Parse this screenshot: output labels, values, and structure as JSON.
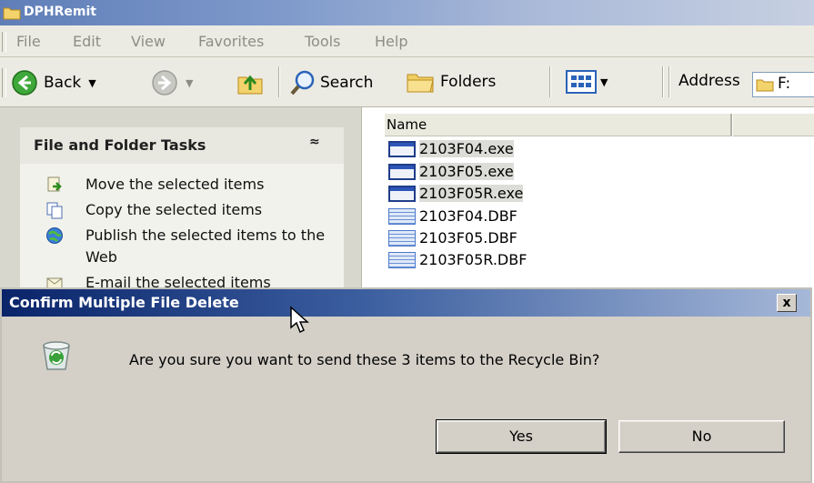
{
  "window": {
    "title": "DPHRemit"
  },
  "menu": [
    "File",
    "Edit",
    "View",
    "Favorites",
    "Tools",
    "Help"
  ],
  "toolbar": {
    "back": "Back",
    "search": "Search",
    "folders": "Folders",
    "address_label": "Address",
    "address_value": "F:"
  },
  "task_pane": {
    "header": "File and Folder Tasks",
    "collapse_glyph": "≈",
    "items": [
      {
        "label": "Move the selected items",
        "icon": "move-icon"
      },
      {
        "label": "Copy the selected items",
        "icon": "copy-icon"
      },
      {
        "label": "Publish the selected items to the Web",
        "icon": "publish-web-icon"
      },
      {
        "label": "E-mail the selected items",
        "icon": "email-icon"
      }
    ]
  },
  "file_list": {
    "column_name": "Name",
    "files": [
      {
        "name": "2103F04.exe",
        "type": "exe",
        "selected": true
      },
      {
        "name": "2103F05.exe",
        "type": "exe",
        "selected": true
      },
      {
        "name": "2103F05R.exe",
        "type": "exe",
        "selected": true
      },
      {
        "name": "2103F04.DBF",
        "type": "dbf",
        "selected": false
      },
      {
        "name": "2103F05.DBF",
        "type": "dbf",
        "selected": false
      },
      {
        "name": "2103F05R.DBF",
        "type": "dbf",
        "selected": false
      }
    ]
  },
  "dialog": {
    "title": "Confirm Multiple File Delete",
    "message": "Are you sure you want to send these 3 items to the Recycle Bin?",
    "close": "x",
    "yes": "Yes",
    "no": "No"
  }
}
